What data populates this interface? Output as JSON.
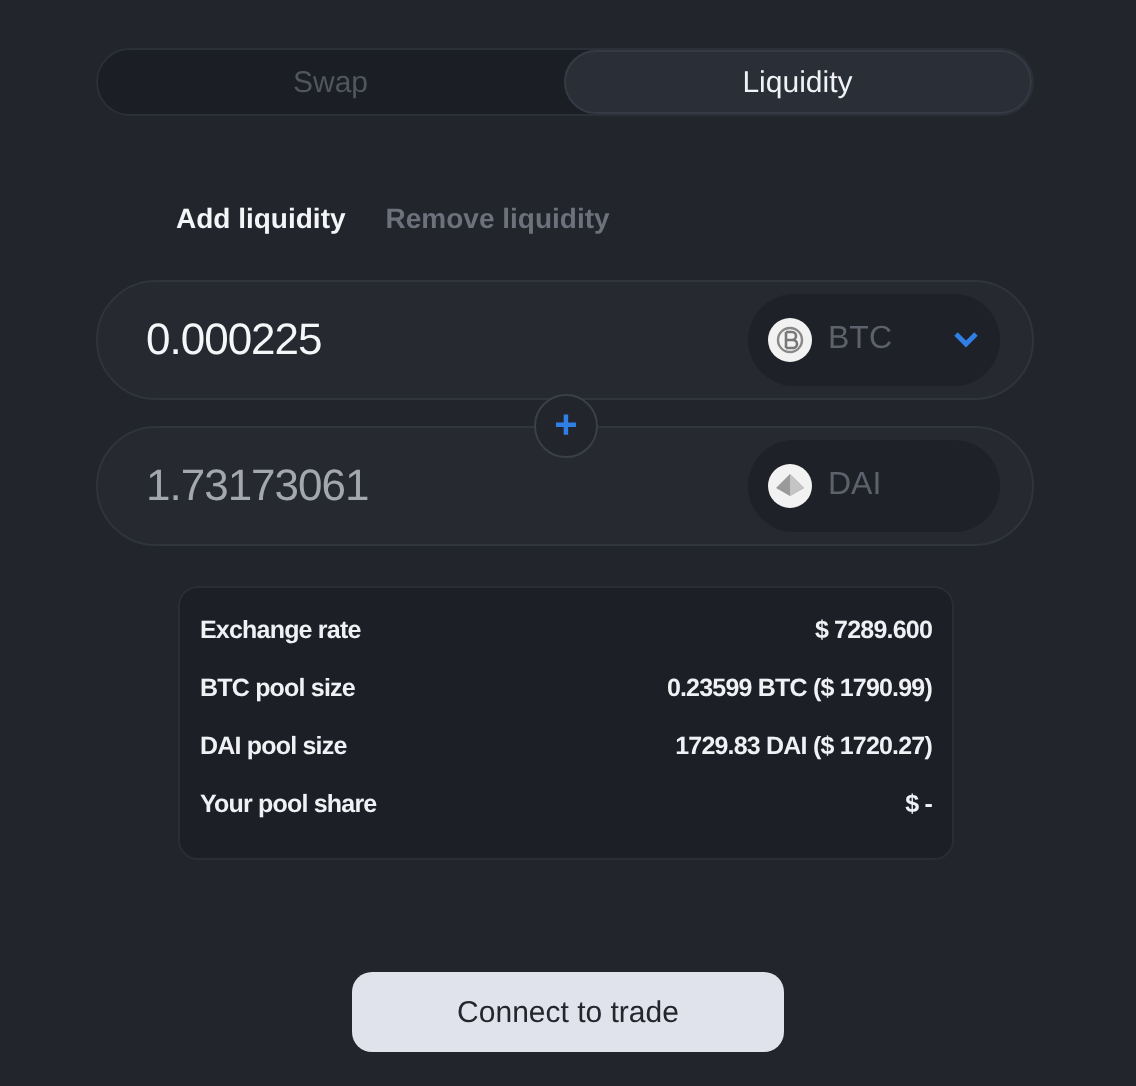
{
  "mode_tabs": [
    {
      "label": "Swap",
      "selected": false
    },
    {
      "label": "Liquidity",
      "selected": true
    }
  ],
  "liquidity_tabs": [
    {
      "label": "Add liquidity",
      "selected": true
    },
    {
      "label": "Remove liquidity",
      "selected": false
    }
  ],
  "inputs": [
    {
      "value": "0.000225",
      "readonly": false,
      "token": {
        "symbol": "BTC",
        "kind": "btc",
        "has_dropdown": true
      }
    },
    {
      "value": "1.73173061",
      "readonly": true,
      "token": {
        "symbol": "DAI",
        "kind": "dai",
        "has_dropdown": false
      }
    }
  ],
  "joiner": "+",
  "info": [
    {
      "label": "Exchange rate",
      "value": "$ 7289.600"
    },
    {
      "label": "BTC pool size",
      "value": "0.23599 BTC ($ 1790.99)"
    },
    {
      "label": "DAI pool size",
      "value": "1729.83 DAI ($ 1720.27)"
    },
    {
      "label": "Your pool share",
      "value": "$ -"
    }
  ],
  "action_button": "Connect to trade"
}
